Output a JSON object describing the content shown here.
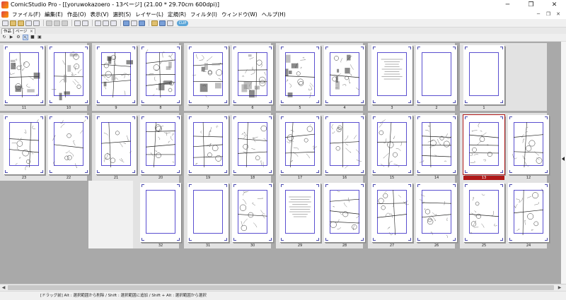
{
  "window": {
    "title": "ComicStudio Pro - [[yoruwokazoero - 13ページ] (21.00 * 29.70cm 600dpi)]",
    "controls": [
      "─",
      "❐",
      "✕"
    ]
  },
  "menu": {
    "items": [
      "ファイル(F)",
      "編集(E)",
      "作品(O)",
      "表示(V)",
      "選択(S)",
      "レイヤー(L)",
      "定規(R)",
      "フィルタ(I)",
      "ウィンドウ(W)",
      "ヘルプ(H)"
    ],
    "mdi_controls": [
      "─",
      "❐",
      "✕"
    ]
  },
  "toolbar": {
    "clip_label": "CLIP"
  },
  "tabs": [
    {
      "label": "作品",
      "closable": false,
      "active": true
    },
    {
      "label": "ページ",
      "closable": true,
      "close_glyph": "✕",
      "active": false
    }
  ],
  "pagetools": [
    "↻",
    "▶",
    "⚙",
    "↖",
    "■",
    "▣"
  ],
  "pages": {
    "selected": "13",
    "rows": [
      [
        "11",
        "10",
        "9",
        "8",
        "7",
        "6",
        "5",
        "4",
        "3",
        "2",
        "1"
      ],
      [
        "23",
        "22",
        "21",
        "20",
        "19",
        "18",
        "17",
        "16",
        "15",
        "14",
        "13",
        "12"
      ],
      [
        "32",
        "31",
        "30",
        "29",
        "28",
        "27",
        "26",
        "25",
        "24"
      ]
    ],
    "shaded": [
      "11",
      "10",
      "9",
      "8",
      "7",
      "6",
      "5",
      "4"
    ],
    "sketched": [
      "23",
      "22",
      "21",
      "20",
      "19",
      "18",
      "17",
      "16",
      "15",
      "14",
      "13",
      "12",
      "30",
      "28",
      "27",
      "26",
      "25",
      "24"
    ],
    "text_pages": [
      "3",
      "29"
    ]
  },
  "status": {
    "text": "[ドラッグ前] Alt : 選択範囲から削除 / Shift : 選択範囲に追加 / Shift + Alt : 選択範囲から選択"
  },
  "colors": {
    "frame": "#5a4fd0",
    "selected_page": "#b01818",
    "workspace": "#a9a9a9"
  }
}
